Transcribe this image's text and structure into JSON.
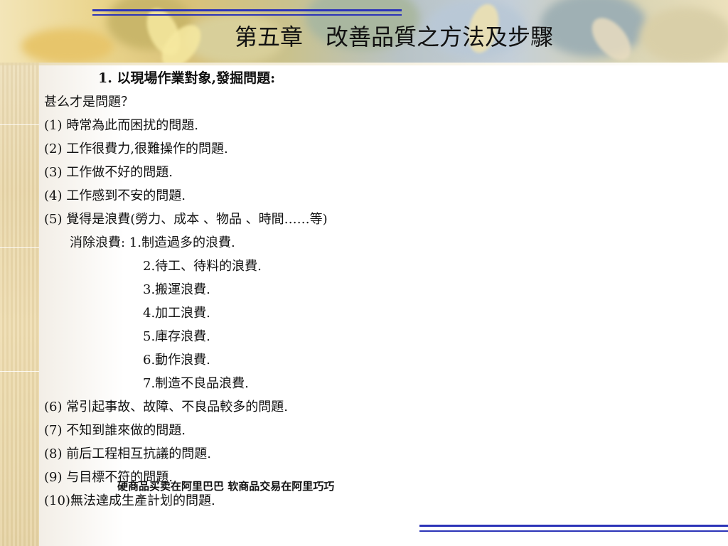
{
  "slide": {
    "title": "第五章　改善品質之方法及步驟",
    "heading": "1.  以現場作業對象,發掘問題:",
    "question": "甚么才是問題？",
    "items": [
      "(1)  時常為此而困扰的問題.",
      "(2)  工作很費力,很難操作的問題.",
      "(3)  工作做不好的問題.",
      "(4)  工作感到不安的問題.",
      "(5)  覺得是浪費(勞力、成本 、物品 、時間……等)"
    ],
    "waste_intro": "消除浪費:  1.制造過多的浪費.",
    "waste_list": [
      "2.待工、待料的浪費.",
      "3.搬運浪費.",
      "4.加工浪費.",
      "5.庫存浪費.",
      "6.動作浪費.",
      "7.制造不良品浪費."
    ],
    "items_after": [
      "(6)  常引起事故、故障、不良品較多的問題.",
      "(7)  不知到誰來做的問題.",
      "(8)  前后工程相互抗議的問題.",
      "(9)  与目標不符的問題.",
      "(10)無法達成生產計划的問題."
    ],
    "watermark": "硬商品买卖在阿里巴巴  软商品交易在阿里巧巧"
  },
  "colors": {
    "accent_blue": "#2c34b8",
    "parchment": "#e9d6a8"
  }
}
